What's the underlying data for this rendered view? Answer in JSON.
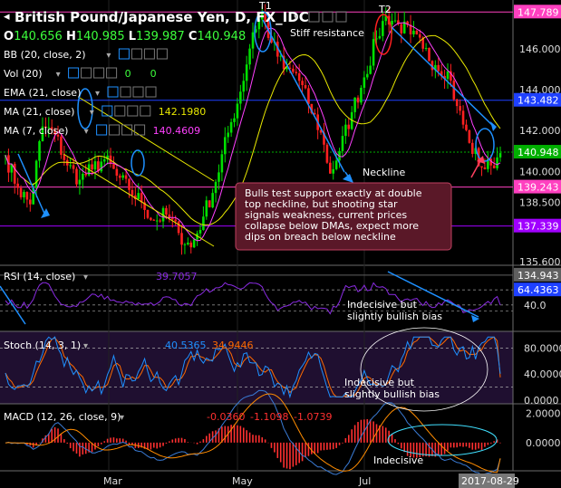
{
  "header": {
    "title": "British Pound/Japanese Yen, D, FX_IDC",
    "ohlc": [
      {
        "k": "O",
        "v": "140.656"
      },
      {
        "k": "H",
        "v": "140.985"
      },
      {
        "k": "L",
        "v": "139.987"
      },
      {
        "k": "C",
        "v": "140.948"
      }
    ]
  },
  "indicators": [
    {
      "label": "BB (20, close, 2)",
      "values": []
    },
    {
      "label": "Vol (20)",
      "values": [
        "0",
        "0"
      ]
    },
    {
      "label": "EMA (21, close)",
      "values": []
    },
    {
      "label": "MA (21, close)",
      "values": [
        "142.1980"
      ]
    },
    {
      "label": "MA (7, close)",
      "values": [
        "140.4609"
      ]
    }
  ],
  "colors": {
    "up": "#00e000",
    "down": "#ff2020",
    "ma21": "#e8e800",
    "ma7": "#ff40ff",
    "accent": "#1e90ff",
    "annotation_bg": "#5a1828",
    "annotation_border": "#c04060",
    "support": "#a000ff",
    "resistance": "#ff40c0",
    "rsi": "#8a2be2",
    "stoch_k": "#1e90ff",
    "stoch_d": "#ff6a00",
    "macd_line": "#3a7bd5",
    "signal_line": "#ff8c00"
  },
  "annotations": {
    "t1": "T1",
    "t2": "T2",
    "stiff": "Stiff resistance",
    "neckline": "Neckline",
    "main_note": [
      "Bulls test support exactly at double",
      "top neckline, but shooting star",
      "signals weakness, current prices",
      "collapse below DMAs, expect more",
      "dips on breach below neckline"
    ],
    "rsi_note": [
      "Indecisive but",
      "slightly bullish bias"
    ],
    "stoch_note": [
      "Indecisive but",
      "slightly bullish bias"
    ],
    "macd_note": "Indecisive"
  },
  "rsi": {
    "label": "RSI (14, close)",
    "value": "39.7057"
  },
  "stoch": {
    "label": "Stoch (14, 3, 1)",
    "k_value": "40.5365",
    "d_value": "34.9446"
  },
  "macd": {
    "label": "MACD (12, 26, close, 9)",
    "values": [
      "-0.0360",
      "-1.1098",
      "-1.0739"
    ]
  },
  "xaxis": {
    "labels": [
      "Mar",
      "May",
      "Jul"
    ],
    "current_date": "2017-08-29"
  },
  "chart_data": {
    "type": "candlestick",
    "main": {
      "ylim": [
        135.6,
        148.2
      ],
      "tick_labels": [
        "146.000",
        "144.000",
        "142.000",
        "140.000",
        "138.500",
        "135.600"
      ],
      "tick_values": [
        146.0,
        144.0,
        142.0,
        140.0,
        138.5,
        135.6
      ],
      "price_labels": [
        {
          "value": 147.789,
          "text": "147.789",
          "color": "#ff40c0"
        },
        {
          "value": 143.482,
          "text": "143.482",
          "color": "#1e40ff"
        },
        {
          "value": 140.948,
          "text": "140.948",
          "color": "#00b000"
        },
        {
          "value": 139.243,
          "text": "139.243",
          "color": "#ff40c0"
        },
        {
          "value": 137.339,
          "text": "137.339",
          "color": "#a000ff"
        },
        {
          "value": 134.943,
          "text": "134.943",
          "color": "#606060"
        }
      ],
      "close_anchors": [
        [
          0,
          140.8
        ],
        [
          4,
          139.2
        ],
        [
          8,
          138.4
        ],
        [
          12,
          142.2
        ],
        [
          16,
          141.8
        ],
        [
          20,
          140.3
        ],
        [
          24,
          139.6
        ],
        [
          28,
          140.1
        ],
        [
          32,
          140.6
        ],
        [
          36,
          139.8
        ],
        [
          40,
          139.1
        ],
        [
          44,
          138.5
        ],
        [
          48,
          137.6
        ],
        [
          52,
          137.9
        ],
        [
          56,
          137.0
        ],
        [
          60,
          136.3
        ],
        [
          64,
          137.8
        ],
        [
          68,
          139.5
        ],
        [
          72,
          141.9
        ],
        [
          76,
          143.9
        ],
        [
          80,
          146.8
        ],
        [
          83,
          147.7
        ],
        [
          86,
          146.3
        ],
        [
          90,
          145.0
        ],
        [
          94,
          144.8
        ],
        [
          98,
          143.3
        ],
        [
          102,
          141.9
        ],
        [
          105,
          139.9
        ],
        [
          108,
          141.0
        ],
        [
          112,
          142.9
        ],
        [
          116,
          144.6
        ],
        [
          120,
          146.5
        ],
        [
          123,
          147.6
        ],
        [
          127,
          147.2
        ],
        [
          131,
          146.7
        ],
        [
          135,
          146.0
        ],
        [
          139,
          145.2
        ],
        [
          143,
          144.9
        ],
        [
          146,
          143.2
        ],
        [
          150,
          141.4
        ],
        [
          154,
          140.2
        ],
        [
          157,
          140.3
        ],
        [
          160,
          140.9
        ]
      ]
    },
    "rsi": {
      "ylim": [
        0,
        100
      ],
      "ticks": [
        40.0
      ],
      "current": 39.7057,
      "level_label": "64.4363"
    },
    "stoch": {
      "ylim": [
        0,
        100
      ],
      "ticks": [
        80.0,
        40.0,
        0.0
      ],
      "k": 40.5365,
      "d": 34.9446
    },
    "macd": {
      "ylim": [
        -1.8,
        2.4
      ],
      "ticks": [
        2.0,
        0.0
      ],
      "macd": -0.036,
      "signal": -1.1098,
      "hist": -1.0739
    }
  }
}
